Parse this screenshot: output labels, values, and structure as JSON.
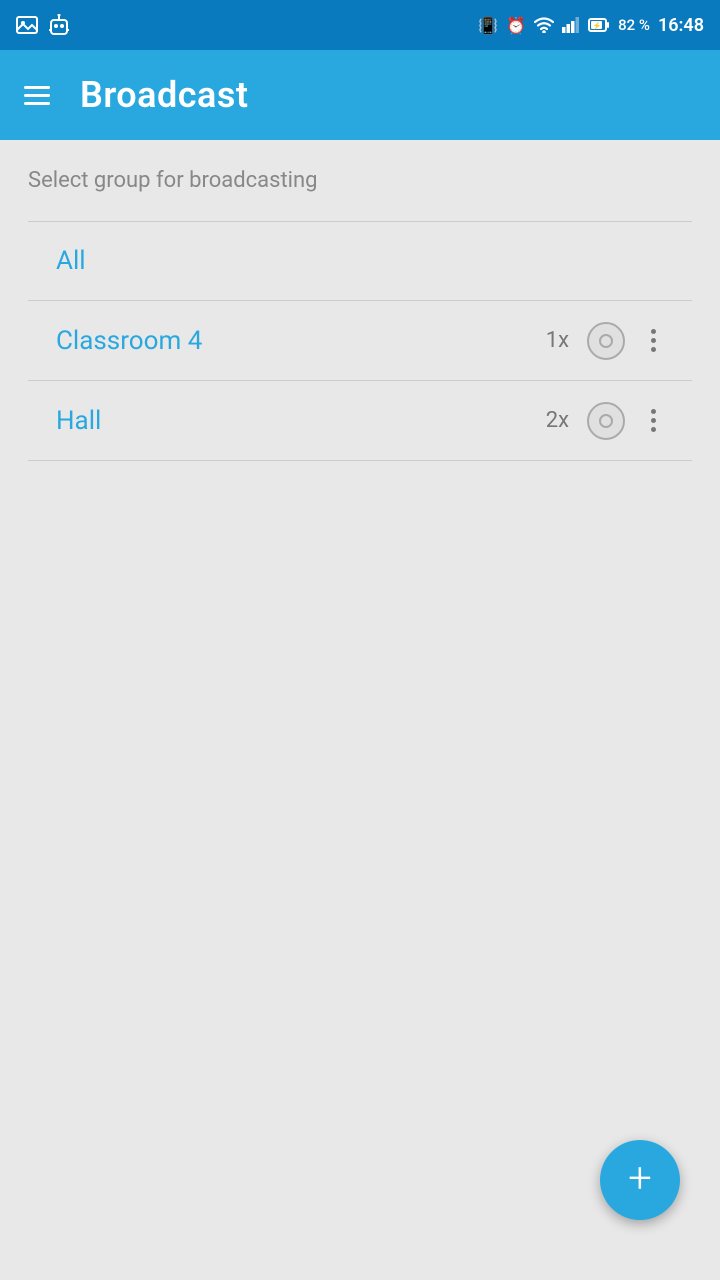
{
  "statusBar": {
    "battery": "82 %",
    "time": "16:48",
    "icons": [
      "vibrate",
      "alarm",
      "wifi",
      "signal",
      "battery"
    ]
  },
  "appBar": {
    "title": "Broadcast",
    "menuIcon": "hamburger-icon"
  },
  "main": {
    "subtitle": "Select group for broadcasting",
    "items": [
      {
        "label": "All",
        "count": null,
        "showRadio": false,
        "showDots": false
      },
      {
        "label": "Classroom 4",
        "count": "1x",
        "showRadio": true,
        "showDots": true
      },
      {
        "label": "Hall",
        "count": "2x",
        "showRadio": true,
        "showDots": true
      }
    ]
  },
  "fab": {
    "label": "+"
  }
}
